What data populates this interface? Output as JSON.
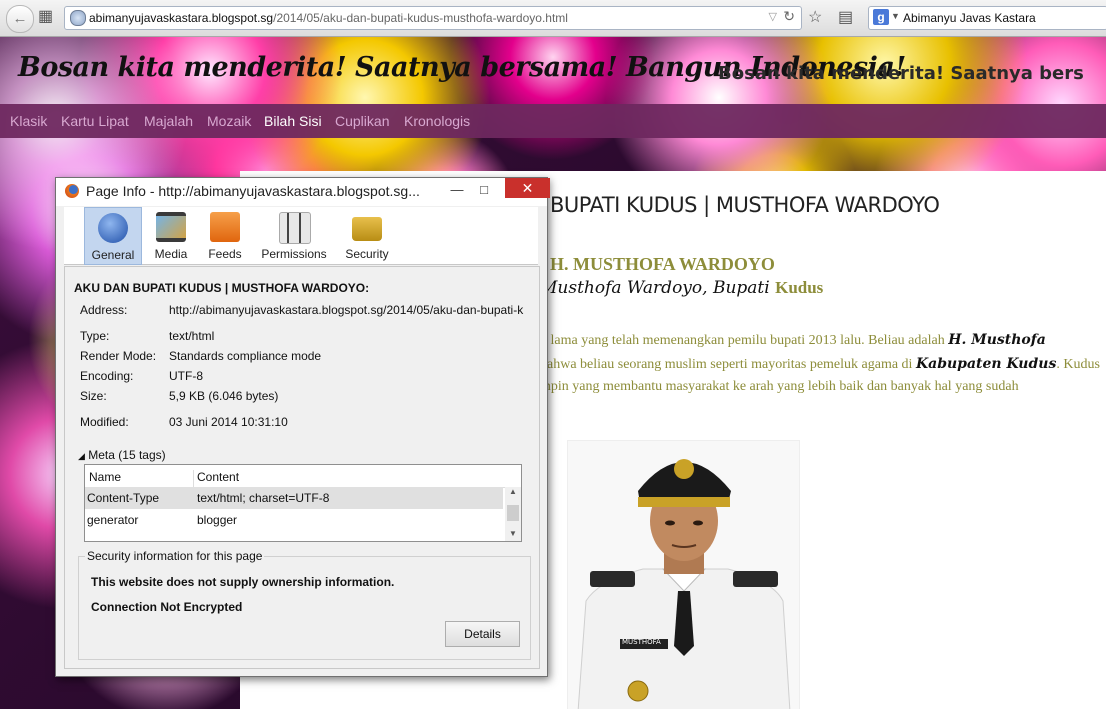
{
  "browser": {
    "url_domain": "abimanyujavaskastara.blogspot.sg",
    "url_path": "/2014/05/aku-dan-bupati-kudus-musthofa-wardoyo.html",
    "search_value": "Abimanyu Javas Kastara"
  },
  "site": {
    "banner": "Bosan kita menderita!  Saatnya bersama!  Bangun Indonesia!",
    "banner_scroll": "Bosan kita menderita! Saatnya bers",
    "menu": [
      "Klasik",
      "Kartu Lipat",
      "Majalah",
      "Mozaik",
      "Bilah Sisi",
      "Cuplikan",
      "Kronologis"
    ],
    "active_menu": "Bilah Sisi"
  },
  "post": {
    "title_visible": "BUPATI KUDUS | MUSTHOFA WARDOYO",
    "subhead": "H. MUSTHOFA WARDOYO",
    "subline_italic": "Musthofa Wardoyo,  Bupati",
    "subline_tail": "Kudus",
    "para_lines": [
      {
        "pre": "n lama yang telah memenangkan pemilu bupati 2013 lalu. Beliau adalah ",
        "italic": "H. Musthofa",
        "post": ""
      },
      {
        "pre": "bahwa beliau seorang muslim seperti mayoritas pemeluk agama di ",
        "italic": "Kabupaten Kudus",
        "post": ". Kudus"
      },
      {
        "pre": "mpin yang membantu masyarakat ke arah yang lebih baik dan banyak hal yang sudah",
        "italic": "",
        "post": ""
      }
    ],
    "photo_badge": "MUSTHOFA"
  },
  "dialog": {
    "title": "Page Info - http://abimanyujavaskastara.blogspot.sg...",
    "tabs": [
      "General",
      "Media",
      "Feeds",
      "Permissions",
      "Security"
    ],
    "page_title": "AKU DAN BUPATI KUDUS | MUSTHOFA WARDOYO:",
    "fields": [
      {
        "label": "Address:",
        "value": "http://abimanyujavaskastara.blogspot.sg/2014/05/aku-dan-bupati-k"
      },
      {
        "label": "Type:",
        "value": "text/html"
      },
      {
        "label": "Render Mode:",
        "value": "Standards compliance mode"
      },
      {
        "label": "Encoding:",
        "value": "UTF-8"
      },
      {
        "label": "Size:",
        "value": "5,9 KB (6.046 bytes)"
      },
      {
        "label": "Modified:",
        "value": "03 Juni 2014 10:31:10"
      }
    ],
    "meta_label": "Meta (15 tags)",
    "meta_columns": [
      "Name",
      "Content"
    ],
    "meta_rows": [
      {
        "name": "Content-Type",
        "content": "text/html; charset=UTF-8"
      },
      {
        "name": "generator",
        "content": "blogger"
      }
    ],
    "security_legend": "Security information for this page",
    "security_ownership": "This website does not supply ownership information.",
    "security_connection": "Connection Not Encrypted",
    "details_button": "Details"
  }
}
